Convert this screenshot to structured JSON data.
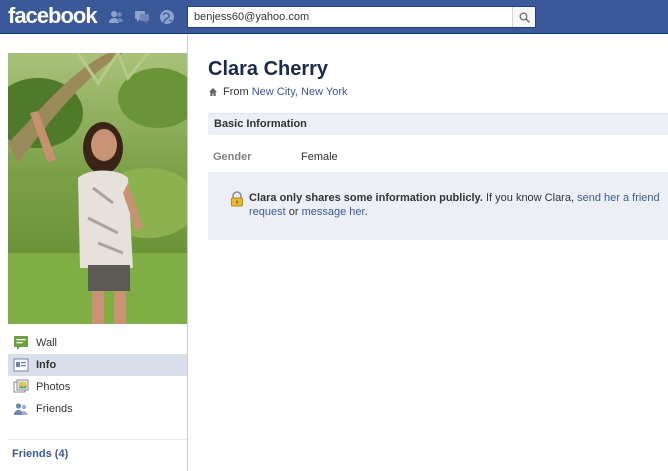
{
  "topbar": {
    "logo": "facebook",
    "icons": [
      "friend-requests-icon",
      "messages-icon",
      "notifications-icon"
    ],
    "search": {
      "value": "benjess60@yahoo.com",
      "button_icon": "search-icon"
    },
    "color": "#3b5998"
  },
  "sidebar": {
    "nav": [
      {
        "label": "Wall",
        "icon": "wall-icon"
      },
      {
        "label": "Info",
        "icon": "info-icon",
        "active": true
      },
      {
        "label": "Photos",
        "icon": "photos-icon"
      },
      {
        "label": "Friends",
        "icon": "friends-icon"
      }
    ],
    "friends_link": "Friends (4)"
  },
  "profile": {
    "name": "Clara Cherry",
    "from_prefix": "From",
    "hometown": "New City, New York",
    "section_title": "Basic Information",
    "fields": [
      {
        "label": "Gender",
        "value": "Female"
      }
    ],
    "notice": {
      "bold": "Clara only shares some information publicly.",
      "text_before": "If you know Clara,",
      "link_friend": "send her a friend request",
      "text_or": "or",
      "link_message": "message her",
      "end": "."
    }
  }
}
